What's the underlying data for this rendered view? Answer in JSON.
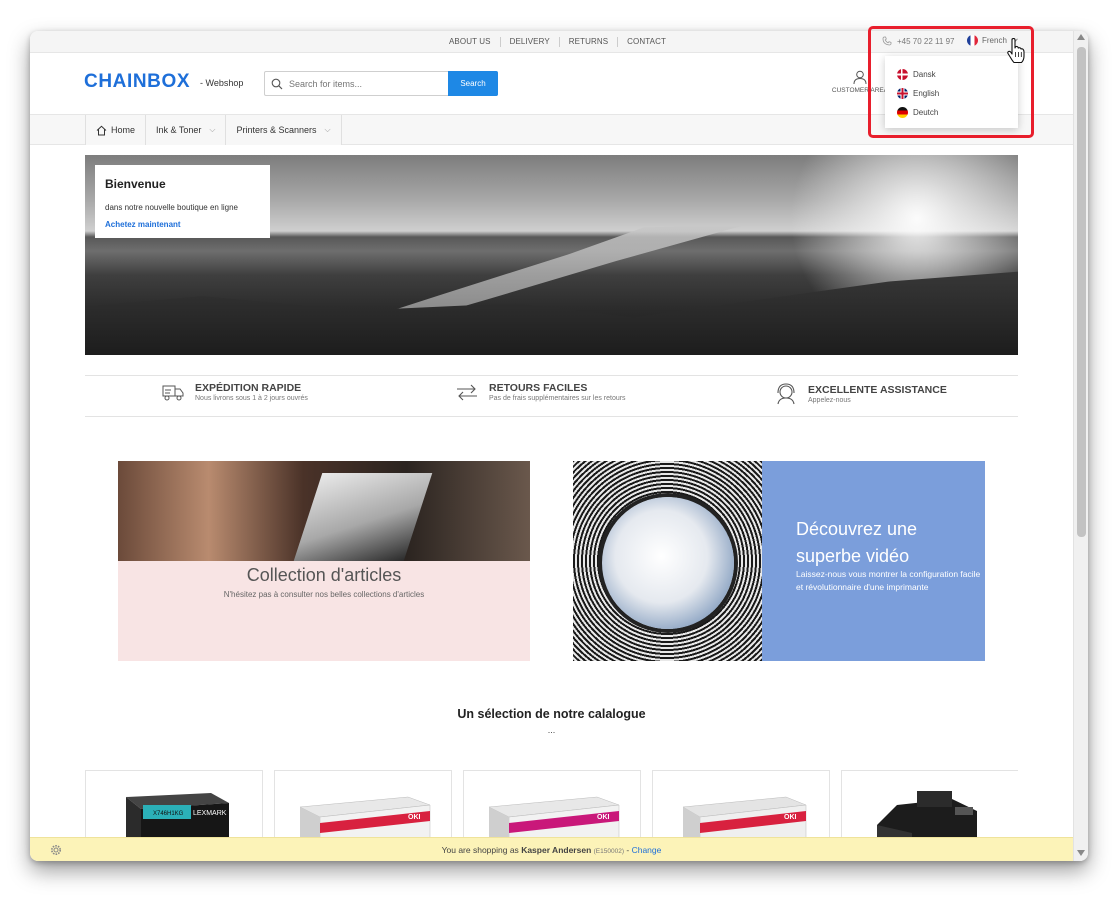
{
  "topbar": {
    "links": [
      "ABOUT US",
      "DELIVERY",
      "RETURNS",
      "CONTACT"
    ],
    "phone": "+45 70 22 11 97",
    "language": "French"
  },
  "header": {
    "logo": "CHAINBOX",
    "subtitle": "- Webshop",
    "search_placeholder": "Search for items...",
    "search_button": "Search",
    "account_label": "CUSTOMER AREA"
  },
  "nav": {
    "items": [
      {
        "label": "Home",
        "icon": "home-icon"
      },
      {
        "label": "Ink & Toner"
      },
      {
        "label": "Printers & Scanners"
      }
    ]
  },
  "hero": {
    "title": "Bienvenue",
    "text": "dans notre nouvelle boutique en ligne",
    "link": "Achetez maintenant"
  },
  "features": [
    {
      "title": "EXPÉDITION RAPIDE",
      "subtitle": "Nous livrons sous 1 à 2 jours ouvrés",
      "icon": "truck-icon"
    },
    {
      "title": "RETOURS FACILES",
      "subtitle": "Pas de frais supplémentaires sur les retours",
      "icon": "return-arrows-icon"
    },
    {
      "title": "EXCELLENTE ASSISTANCE",
      "subtitle": "Appelez-nous",
      "icon": "support-headset-icon"
    }
  ],
  "cards": {
    "collection": {
      "title": "Collection d'articles",
      "subtitle": "N'hésitez pas à consulter nos belles collections d'articles"
    },
    "video": {
      "title": "Découvrez une superbe vidéo",
      "subtitle": "Laissez-nous vous montrer la configuration facile et révolutionnaire d'une imprimante"
    }
  },
  "selection": {
    "title": "Un sélection de notre calalogue",
    "dots": "..."
  },
  "products": {
    "brand_lexmark": "LEXMARK",
    "model_lexmark": "X746H1KG",
    "brand_oki": "OKI",
    "colors": [
      "#d8213f",
      "#c9187a",
      "#d8213f",
      "#c9c9c9"
    ]
  },
  "dropdown": {
    "options": [
      {
        "label": "Dansk",
        "flag": "dk"
      },
      {
        "label": "English",
        "flag": "gb"
      },
      {
        "label": "Deutch",
        "flag": "de"
      }
    ]
  },
  "status": {
    "prefix": "You are shopping as",
    "user": "Kasper Andersen",
    "customer_id": "(E150002)",
    "separator": "-",
    "change": "Change"
  },
  "colors": {
    "brand": "#1e6fd9",
    "search_button": "#1e88e5",
    "highlight": "#e81e2c",
    "status_bg": "#fcf3b8"
  }
}
